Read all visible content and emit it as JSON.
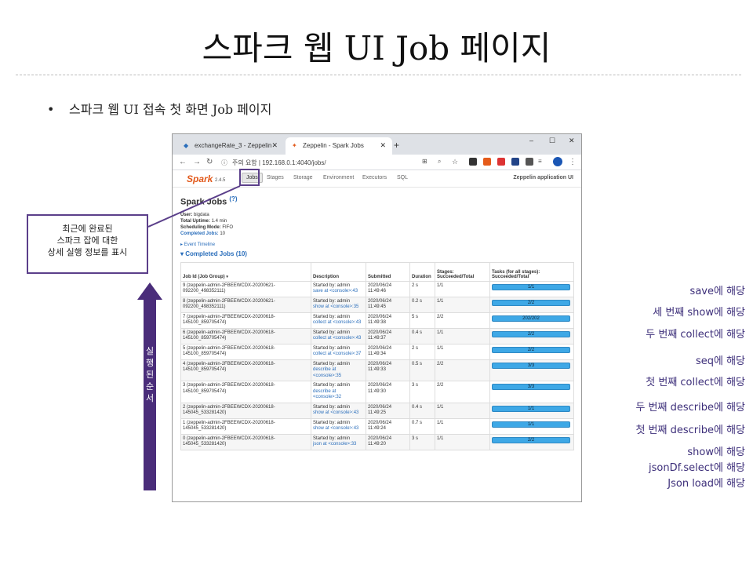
{
  "slide": {
    "title": "스파크 웹 UI Job 페이지",
    "bullet": "스파크 웹 UI 접속 첫 화면 Job 페이지"
  },
  "browser": {
    "tabs": [
      {
        "label": "exchangeRate_3 - Zeppelin",
        "icon": "zeppelin-icon"
      },
      {
        "label": "Zeppelin - Spark Jobs",
        "icon": "spark-icon"
      }
    ],
    "window_controls": [
      "–",
      "☐",
      "✕"
    ],
    "security_label": "주의 요함",
    "url": "192.168.0.1:4040/jobs/"
  },
  "spark_nav": {
    "logo": "Spark",
    "version": "2.4.5",
    "items": [
      "Jobs",
      "Stages",
      "Storage",
      "Environment",
      "Executors",
      "SQL"
    ],
    "app_name": "Zeppelin application UI"
  },
  "page": {
    "title": "Spark Jobs",
    "help": "(?)",
    "user_label": "User:",
    "user": "bigdata",
    "uptime_label": "Total Uptime:",
    "uptime": "1.4 min",
    "sched_label": "Scheduling Mode:",
    "sched": "FIFO",
    "completed_label": "Completed Jobs:",
    "completed_count": "10",
    "timeline": "Event Timeline",
    "completed_header": "Completed Jobs (10)"
  },
  "table": {
    "headers": [
      "Job Id (Job Group)",
      "Description",
      "Submitted",
      "Duration",
      "Stages: Succeeded/Total",
      "Tasks (for all stages): Succeeded/Total"
    ],
    "rows": [
      {
        "id": "9 (zeppelin-admin-2FBEEWCDX-20200621-092200_498352111)",
        "started": "Started by: admin",
        "desc": "save at <console>:43",
        "submitted": "2020/06/24 11:49:46",
        "duration": "2 s",
        "stages": "1/1",
        "tasks": "1/1",
        "task_fraction": 1
      },
      {
        "id": "8 (zeppelin-admin-2FBEEWCDX-20200621-092200_498352111)",
        "started": "Started by: admin",
        "desc": "show at <console>:35",
        "submitted": "2020/06/24 11:49:45",
        "duration": "0.2 s",
        "stages": "1/1",
        "tasks": "2/2",
        "task_fraction": 1
      },
      {
        "id": "7 (zeppelin-admin-2FBEEWCDX-20200618-145100_859705474)",
        "started": "Started by: admin",
        "desc": "collect at <console>:43",
        "submitted": "2020/06/24 11:49:38",
        "duration": "5 s",
        "stages": "2/2",
        "tasks": "202/202",
        "task_fraction": 1
      },
      {
        "id": "6 (zeppelin-admin-2FBEEWCDX-20200618-145100_859705474)",
        "started": "Started by: admin",
        "desc": "collect at <console>:43",
        "submitted": "2020/06/24 11:49:37",
        "duration": "0.4 s",
        "stages": "1/1",
        "tasks": "2/2",
        "task_fraction": 1
      },
      {
        "id": "5 (zeppelin-admin-2FBEEWCDX-20200618-145100_859705474)",
        "started": "Started by: admin",
        "desc": "collect at <console>:37",
        "submitted": "2020/06/24 11:49:34",
        "duration": "2 s",
        "stages": "1/1",
        "tasks": "2/2",
        "task_fraction": 1
      },
      {
        "id": "4 (zeppelin-admin-2FBEEWCDX-20200618-145100_859705474)",
        "started": "Started by: admin",
        "desc": "describe at <console>:35",
        "submitted": "2020/06/24 11:49:33",
        "duration": "0.5 s",
        "stages": "2/2",
        "tasks": "3/3",
        "task_fraction": 1
      },
      {
        "id": "3 (zeppelin-admin-2FBEEWCDX-20200618-145100_859705474)",
        "started": "Started by: admin",
        "desc": "describe at <console>:32",
        "submitted": "2020/06/24 11:49:30",
        "duration": "3 s",
        "stages": "2/2",
        "tasks": "3/3",
        "task_fraction": 1
      },
      {
        "id": "2 (zeppelin-admin-2FBEEWCDX-20200618-145045_533281420)",
        "started": "Started by: admin",
        "desc": "show at <console>:43",
        "submitted": "2020/06/24 11:49:25",
        "duration": "0.4 s",
        "stages": "1/1",
        "tasks": "1/1",
        "task_fraction": 1
      },
      {
        "id": "1 (zeppelin-admin-2FBEEWCDX-20200618-145045_533281420)",
        "started": "Started by: admin",
        "desc": "show at <console>:43",
        "submitted": "2020/06/24 11:49:24",
        "duration": "0.7 s",
        "stages": "1/1",
        "tasks": "1/1",
        "task_fraction": 1
      },
      {
        "id": "0 (zeppelin-admin-2FBEEWCDX-20200618-145045_533281420)",
        "started": "Started by: admin",
        "desc": "json at <console>:33",
        "submitted": "2020/06/24 11:49:20",
        "duration": "3 s",
        "stages": "1/1",
        "tasks": "2/2",
        "task_fraction": 1
      }
    ]
  },
  "annotations": {
    "callout": [
      "최근에 완료된",
      "스파크 잡에 대한",
      "상세 실행 정보를 표시"
    ],
    "arrow_label": "실행된순서",
    "right_notes": [
      "save에 해당",
      "세 번째 show에 해당",
      "두 번째 collect에 해당",
      "seq에 해당",
      "첫 번째 collect에 해당",
      "두 번째 describe에 해당",
      "첫 번째 describe에 해당",
      "show에 해당",
      "jsonDf.select에 해당",
      "Json load에 해당"
    ]
  },
  "colors": {
    "accent": "#5b3f8a",
    "bar": "#3ea8e6",
    "link": "#2a6ebb",
    "spark_orange": "#e25a1c"
  }
}
